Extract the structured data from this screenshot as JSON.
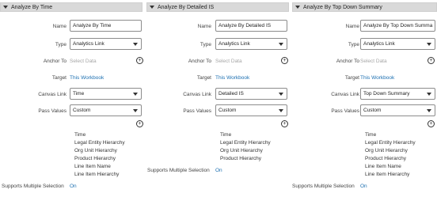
{
  "labels": {
    "name": "Name",
    "type": "Type",
    "anchor_to": "Anchor To",
    "target": "Target",
    "canvas_link": "Canvas Link",
    "pass_values": "Pass Values",
    "supports_multiple_selection": "Supports Multiple Selection"
  },
  "icons": {
    "add": "plus-circle-icon",
    "expand": "caret-down-icon",
    "dropdown": "chevron-down-icon"
  },
  "colors": {
    "link": "#1c6fb1",
    "header_bg": "#d9d9d9"
  },
  "panels": [
    {
      "title": "Analyze By Time",
      "name_value": "Analyze By Time",
      "type_value": "Analytics Link",
      "anchor_placeholder": "Select Data",
      "target_value": "This Workbook",
      "canvas_link_value": "Time",
      "pass_values_value": "Custom",
      "hierarchies": [
        "Time",
        "Legal Entity Hierarchy",
        "Org Unit Hierarchy",
        "Product Hierarchy",
        "Line Item Name",
        "Line Item Hierarchy"
      ],
      "supports_multiple_selection_value": "On"
    },
    {
      "title": "Analyze By Detailed IS",
      "name_value": "Analyze By Detailed IS",
      "type_value": "Analytics Link",
      "anchor_placeholder": "Select Data",
      "target_value": "This Workbook",
      "canvas_link_value": "Detailed IS",
      "pass_values_value": "Custom",
      "hierarchies": [
        "Time",
        "Legal Entity Hierarchy",
        "Org Unit Hierarchy",
        "Product Hierarchy"
      ],
      "supports_multiple_selection_value": "On"
    },
    {
      "title": "Analyze By Top Down Summary",
      "name_value": "Analyze By Top Down Summa",
      "type_value": "Analytics Link",
      "anchor_placeholder": "Select Data",
      "target_value": "This Workbook",
      "canvas_link_value": "Top Down Summary",
      "pass_values_value": "Custom",
      "hierarchies": [
        "Time",
        "Legal Entity Hierarchy",
        "Org Unit Hierarchy",
        "Product Hierarchy",
        "Line Item Name",
        "Line Item Hierarchy"
      ],
      "supports_multiple_selection_value": "On"
    }
  ]
}
